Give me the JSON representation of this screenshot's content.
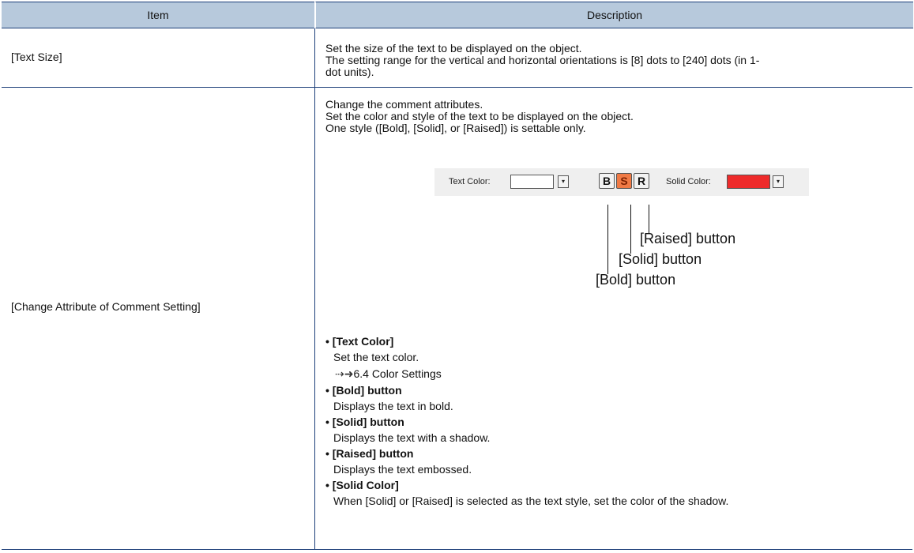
{
  "header": {
    "col_item": "Item",
    "col_description": "Description"
  },
  "rows": [
    {
      "item": "[Text Size]",
      "lines": [
        "Set the size of the text to be displayed on the object.",
        "The setting range for the vertical and horizontal orientations is [8] dots to [240] dots (in 1-",
        "dot units)."
      ]
    },
    {
      "item": "[Change Attribute of Comment Setting]",
      "lines": [
        "Change the comment attributes.",
        "Set the color and style of the text to be displayed on the object.",
        "One style ([Bold], [Solid], or [Raised]) is settable only."
      ],
      "toolbar": {
        "text_color_label": "Text Color:",
        "solid_color_label": "Solid Color:",
        "bold_letter": "B",
        "solid_letter": "S",
        "raised_letter": "R",
        "dropdown_glyph": "▾",
        "text_color_value": "#ffffff",
        "solid_color_value": "#ee2b2b",
        "solid_button_color": "#f07a45"
      },
      "callouts": {
        "raised": "[Raised] button",
        "solid": "[Solid] button",
        "bold": "[Bold] button"
      },
      "bullets": [
        {
          "title": "• [Text Color]",
          "text": "Set the text color.",
          "link": "6.4 Color Settings"
        },
        {
          "title": "• [Bold] button",
          "text": "Displays the text in bold."
        },
        {
          "title": "• [Solid] button",
          "text": "Displays the text with a shadow."
        },
        {
          "title": "• [Raised] button",
          "text": "Displays the text embossed."
        },
        {
          "title": "• [Solid Color]",
          "text": "When [Solid] or [Raised] is selected as the text style, set the color of the shadow."
        }
      ]
    }
  ]
}
